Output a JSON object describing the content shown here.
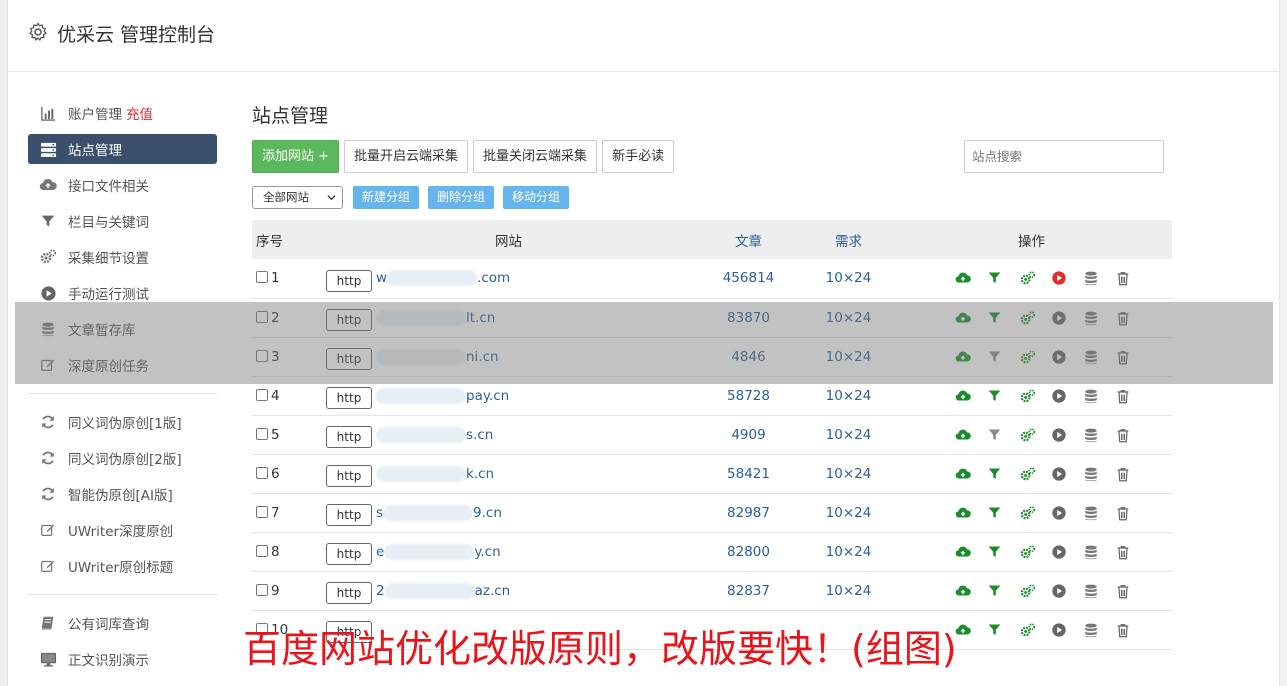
{
  "header": {
    "title": "优采云 管理控制台"
  },
  "sidebar": {
    "group1": [
      {
        "label": "账户管理",
        "extra": "充值",
        "icon": "bar-chart-icon"
      },
      {
        "label": "站点管理",
        "icon": "server-list-icon",
        "active": true
      },
      {
        "label": "接口文件相关",
        "icon": "cloud-upload-icon"
      },
      {
        "label": "栏目与关键词",
        "icon": "filter-icon"
      },
      {
        "label": "采集细节设置",
        "icon": "gears-icon"
      },
      {
        "label": "手动运行测试",
        "icon": "play-circle-icon"
      },
      {
        "label": "文章暂存库",
        "icon": "database-icon"
      },
      {
        "label": "深度原创任务",
        "icon": "edit-icon"
      }
    ],
    "group2": [
      {
        "label": "同义词伪原创[1版]",
        "icon": "refresh-icon"
      },
      {
        "label": "同义词伪原创[2版]",
        "icon": "refresh-icon"
      },
      {
        "label": "智能伪原创[AI版]",
        "icon": "refresh-icon"
      },
      {
        "label": "UWriter深度原创",
        "icon": "edit-icon"
      },
      {
        "label": "UWriter原创标题",
        "icon": "edit-icon"
      }
    ],
    "group3": [
      {
        "label": "公有词库查询",
        "icon": "book-icon"
      },
      {
        "label": "正文识别演示",
        "icon": "monitor-icon"
      }
    ]
  },
  "main": {
    "title": "站点管理",
    "toolbar": {
      "add": "添加网站 +",
      "batch_on": "批量开启云端采集",
      "batch_off": "批量关闭云端采集",
      "guide": "新手必读",
      "search_placeholder": "站点搜索"
    },
    "filter": {
      "select_value": "全部网站",
      "new_group": "新建分组",
      "delete_group": "删除分组",
      "move_group": "移动分组"
    },
    "table": {
      "headers": {
        "no": "序号",
        "site": "网站",
        "articles": "文章",
        "demand": "需求",
        "ops": "操作"
      },
      "rows": [
        {
          "no": "1",
          "http": "http",
          "domain": "w",
          "domain_tail": ".com",
          "articles": "456814",
          "demand": "10×24",
          "play_active": true,
          "filter_active": true
        },
        {
          "no": "2",
          "http": "http",
          "domain": "",
          "domain_tail": "lt.cn",
          "articles": "83870",
          "demand": "10×24",
          "play_active": false,
          "filter_active": true
        },
        {
          "no": "3",
          "http": "http",
          "domain": "",
          "domain_tail": "ni.cn",
          "articles": "4846",
          "demand": "10×24",
          "play_active": false,
          "filter_active": false
        },
        {
          "no": "4",
          "http": "http",
          "domain": "",
          "domain_tail": "pay.cn",
          "articles": "58728",
          "demand": "10×24",
          "play_active": false,
          "filter_active": true
        },
        {
          "no": "5",
          "http": "http",
          "domain": "",
          "domain_tail": "s.cn",
          "articles": "4909",
          "demand": "10×24",
          "play_active": false,
          "filter_active": false
        },
        {
          "no": "6",
          "http": "http",
          "domain": "",
          "domain_tail": "k.cn",
          "articles": "58421",
          "demand": "10×24",
          "play_active": false,
          "filter_active": true
        },
        {
          "no": "7",
          "http": "http",
          "domain": "s",
          "domain_tail": "9.cn",
          "articles": "82987",
          "demand": "10×24",
          "play_active": false,
          "filter_active": true
        },
        {
          "no": "8",
          "http": "http",
          "domain": "e",
          "domain_tail": "y.cn",
          "articles": "82800",
          "demand": "10×24",
          "play_active": false,
          "filter_active": true
        },
        {
          "no": "9",
          "http": "http",
          "domain": "2",
          "domain_tail": "az.cn",
          "articles": "82837",
          "demand": "10×24",
          "play_active": false,
          "filter_active": true
        },
        {
          "no": "10",
          "http": "http",
          "domain": "",
          "domain_tail": "",
          "articles": "",
          "demand": "",
          "play_active": false,
          "filter_active": true
        }
      ]
    }
  },
  "banner": {
    "text": "百度网站优化改版原则，改版要快！(组图)"
  },
  "colors": {
    "accent_green": "#5cb85c",
    "sidebar_active": "#3a4f6c",
    "link_blue": "#2a5f9e",
    "tag_blue": "#66b4ec",
    "banner_red": "#e8141a",
    "cloud_green": "#1a8c2a",
    "play_red": "#e52a2a"
  }
}
